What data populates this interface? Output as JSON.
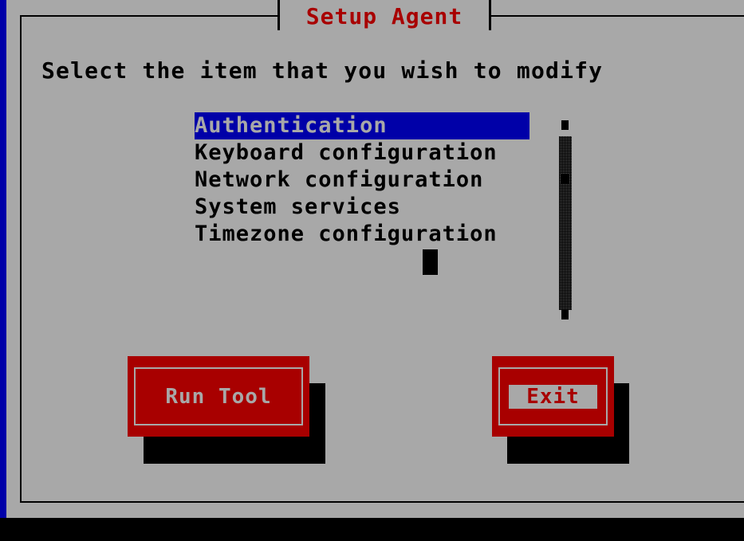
{
  "window": {
    "title": "Setup Agent"
  },
  "prompt": "Select the item that you wish to modify",
  "list": {
    "items": [
      {
        "label": "Authentication",
        "selected": true
      },
      {
        "label": "Keyboard configuration",
        "selected": false
      },
      {
        "label": "Network configuration",
        "selected": false
      },
      {
        "label": "System services",
        "selected": false
      },
      {
        "label": "Timezone configuration",
        "selected": false
      }
    ]
  },
  "buttons": {
    "run_tool": "Run Tool",
    "exit": "Exit"
  },
  "colors": {
    "screen": "#0000a8",
    "dialog": "#a8a8a8",
    "title": "#a80000",
    "button": "#a80000",
    "selection": "#0000a8"
  },
  "icons": {
    "scroll_up": "scroll-up-arrow-icon",
    "scroll_down": "scroll-down-arrow-icon",
    "cursor": "cursor-block-icon"
  }
}
